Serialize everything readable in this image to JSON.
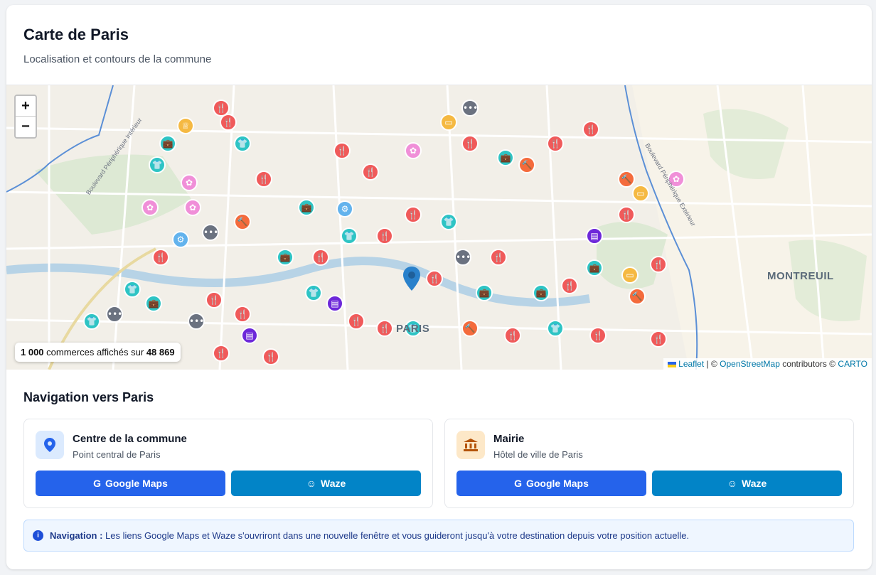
{
  "header": {
    "title": "Carte de Paris",
    "subtitle": "Localisation et contours de la commune"
  },
  "map": {
    "zoom_in": "+",
    "zoom_out": "−",
    "place_labels": {
      "montreuil": "MONTREUIL",
      "paris": "PARIS"
    },
    "street_labels": {
      "bd_peripherique_ouest": "Boulevard Périphérique Intérieur",
      "bd_peripherique_est": "Boulevard Périphérique Extérieur"
    },
    "count": {
      "shown": "1 000",
      "middle": " commerces affichés sur ",
      "total": "48 869"
    },
    "attribution": {
      "leaflet": "Leaflet",
      "sep1": " | © ",
      "osm": "OpenStreetMap",
      "mid": " contributors © ",
      "carto": "CARTO"
    },
    "marker_colors": {
      "restaurant": "#f05a5a",
      "shop": "#2ec4c4",
      "beauty": "#f08fd8",
      "service": "#6b7280",
      "hotel": "#f5b942",
      "artisan": "#f46b3c",
      "books": "#6d28d9",
      "health": "#63b3ed"
    }
  },
  "navigation": {
    "title": "Navigation vers Paris",
    "center": {
      "icon": "map-pin-icon",
      "title": "Centre de la commune",
      "subtitle": "Point central de Paris",
      "google": "Google Maps",
      "waze": "Waze"
    },
    "mairie": {
      "icon": "town-hall-icon",
      "title": "Mairie",
      "subtitle": "Hôtel de ville de Paris",
      "google": "Google Maps",
      "waze": "Waze"
    },
    "colors": {
      "google": "#2563eb",
      "waze": "#0284c7"
    },
    "info": {
      "label": "Navigation :",
      "text": " Les liens Google Maps et Waze s'ouvriront dans une nouvelle fenêtre et vous guideront jusqu'à votre destination depuis votre position actuelle."
    }
  }
}
